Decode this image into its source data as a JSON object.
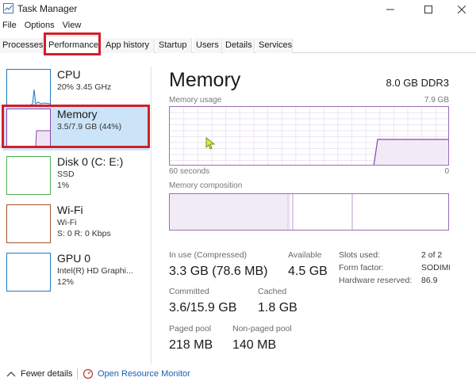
{
  "window": {
    "title": "Task Manager"
  },
  "menu": [
    "File",
    "Options",
    "View"
  ],
  "tabs": [
    "Processes",
    "Performance",
    "App history",
    "Startup",
    "Users",
    "Details",
    "Services"
  ],
  "active_tab": "Performance",
  "sidebar": {
    "items": [
      {
        "title": "CPU",
        "line1": "20%  3.45 GHz",
        "line2": "",
        "color": "#1f78c1"
      },
      {
        "title": "Memory",
        "line1": "3.5/7.9 GB (44%)",
        "line2": "",
        "color": "#8e44ad",
        "selected": true
      },
      {
        "title": "Disk 0 (C: E:)",
        "line1": "SSD",
        "line2": "1%",
        "color": "#4caf50"
      },
      {
        "title": "Wi-Fi",
        "line1": "Wi-Fi",
        "line2": "S: 0  R: 0 Kbps",
        "color": "#a0522d"
      },
      {
        "title": "GPU 0",
        "line1": "Intel(R) HD Graphi...",
        "line2": "12%",
        "color": "#1f78c1"
      }
    ]
  },
  "main": {
    "title": "Memory",
    "spec": "8.0 GB DDR3",
    "usage_label": "Memory usage",
    "usage_max": "7.9 GB",
    "time_left": "60 seconds",
    "time_right": "0",
    "composition_label": "Memory composition",
    "accent_color": "#8e44ad",
    "usage_percent": 44,
    "stats": {
      "in_use_label": "In use (Compressed)",
      "in_use_value": "3.3 GB (78.6 MB)",
      "available_label": "Available",
      "available_value": "4.5 GB",
      "committed_label": "Committed",
      "committed_value": "3.6/15.9 GB",
      "cached_label": "Cached",
      "cached_value": "1.8 GB",
      "paged_label": "Paged pool",
      "paged_value": "218 MB",
      "nonpaged_label": "Non-paged pool",
      "nonpaged_value": "140 MB"
    },
    "details": [
      {
        "key": "Slots used:",
        "value": "2 of 2"
      },
      {
        "key": "Form factor:",
        "value": "SODIMM"
      },
      {
        "key": "Hardware reserved:",
        "value": "86.9 MB"
      }
    ]
  },
  "footer": {
    "fewer_details": "Fewer details",
    "open_resource_monitor": "Open Resource Monitor"
  }
}
